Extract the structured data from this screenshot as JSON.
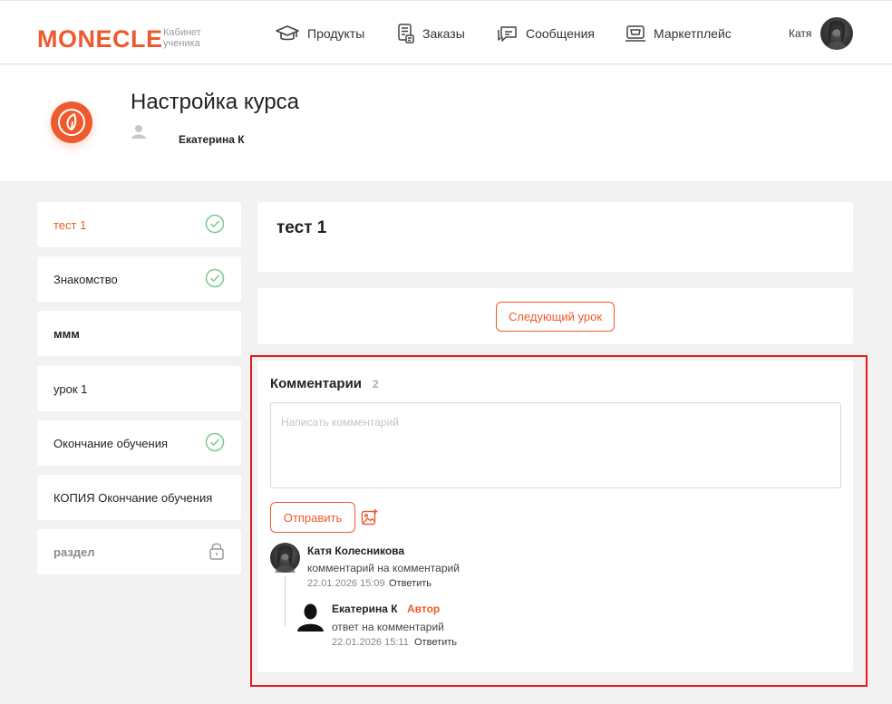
{
  "header": {
    "logo": "MONECLE",
    "logo_sub_1": "Кабинет",
    "logo_sub_2": "ученика",
    "nav": [
      {
        "label": "Продукты",
        "icon": "graduation-cap-icon"
      },
      {
        "label": "Заказы",
        "icon": "orders-icon"
      },
      {
        "label": "Сообщения",
        "icon": "messages-icon"
      },
      {
        "label": "Маркетплейс",
        "icon": "marketplace-icon"
      }
    ],
    "user_name": "Катя"
  },
  "course": {
    "title": "Настройка курса",
    "author": "Екатерина К"
  },
  "sidebar": {
    "lessons": [
      {
        "label": "тест 1",
        "status": "done",
        "active": true
      },
      {
        "label": "Знакомство",
        "status": "done"
      },
      {
        "label": "ммм",
        "status": "none"
      },
      {
        "label": "урок 1",
        "status": "none"
      },
      {
        "label": "Окончание обучения",
        "status": "done"
      },
      {
        "label": "КОПИЯ Окончание обучения",
        "status": "none"
      },
      {
        "label": "раздел",
        "status": "locked"
      }
    ]
  },
  "lesson": {
    "title": "тест 1",
    "next_button": "Следующий урок"
  },
  "comments": {
    "title": "Комментарии",
    "count": "2",
    "placeholder": "Написать комментарий",
    "send_button": "Отправить",
    "items": [
      {
        "author": "Катя Колесникова",
        "text": "комментарий на комментарий",
        "date": "22.01.2026 15:09",
        "reply": "Ответить"
      },
      {
        "author": "Екатерина К",
        "badge": "Автор",
        "text": "ответ на комментарий",
        "date": "22.01.2026 15:11",
        "reply": "Ответить"
      }
    ]
  },
  "colors": {
    "accent": "#ee5a2d",
    "done": "#7cc98a",
    "highlight": "#e01b1b"
  }
}
